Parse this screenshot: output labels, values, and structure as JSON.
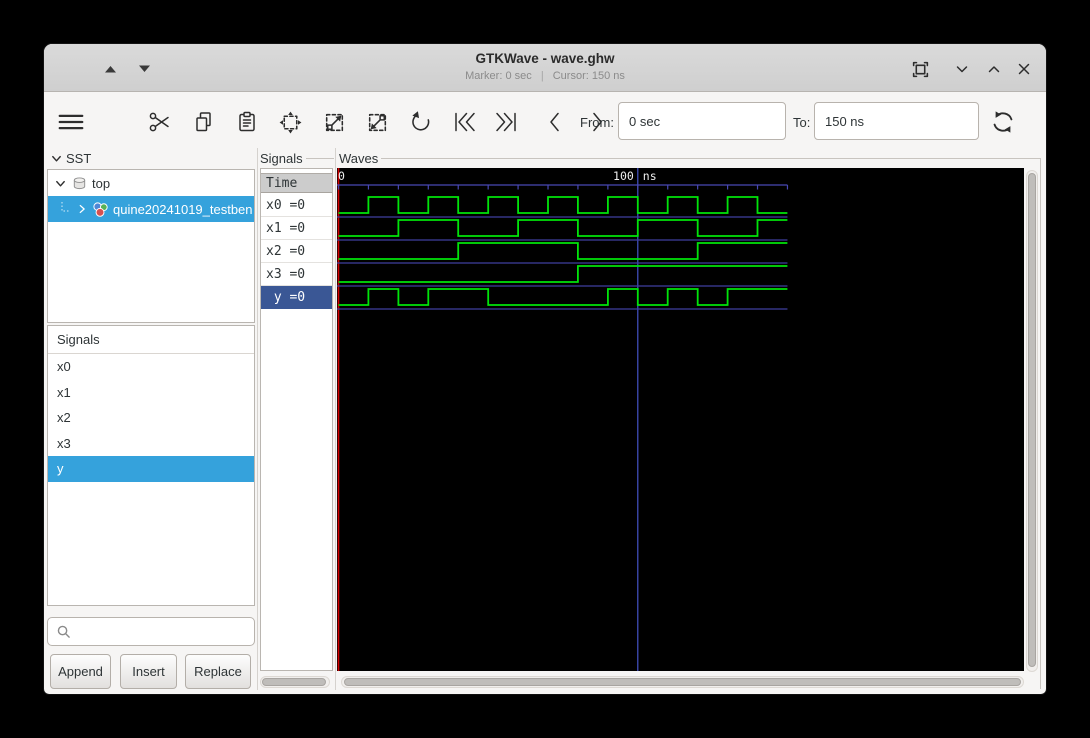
{
  "window": {
    "title": "GTKWave - wave.ghw",
    "subtitle_marker": "Marker: 0 sec",
    "subtitle_sep": "|",
    "subtitle_cursor": "Cursor: 150 ns"
  },
  "toolbar": {
    "from_label": "From:",
    "from_value": "0 sec",
    "to_label": "To:",
    "to_value": "150 ns"
  },
  "sst": {
    "header": "SST",
    "items": [
      {
        "label": "top",
        "expanded": true,
        "selected": false
      },
      {
        "label": "quine20241019_testben",
        "expanded": false,
        "selected": true
      }
    ]
  },
  "filter": {
    "header": "Signals",
    "items": [
      "x0",
      "x1",
      "x2",
      "x3",
      "y"
    ],
    "selected_item": "y",
    "search_placeholder": "",
    "buttons": [
      "Append",
      "Insert",
      "Replace"
    ]
  },
  "values_panel": {
    "header": "Signals",
    "time_header": "Time",
    "rows": [
      {
        "label": "x0 =0"
      },
      {
        "label": "x1 =0"
      },
      {
        "label": "x2 =0"
      },
      {
        "label": "x3 =0"
      },
      {
        "label": " y =0",
        "selected": true
      }
    ]
  },
  "waves_panel": {
    "header": "Waves"
  },
  "chart_data": {
    "type": "digital-waveform",
    "title": "Waves",
    "time_unit": "ns",
    "time_start": 0,
    "time_end": 150,
    "tick_interval_ns": 10,
    "ruler_labels": [
      {
        "time": 0,
        "number": "0",
        "unit": ""
      },
      {
        "time": 100,
        "number": "100",
        "unit": "ns"
      }
    ],
    "marker_time_ns": 0,
    "cursor_line_time_ns": 100,
    "signals": [
      {
        "name": "x0",
        "current_value": "0",
        "high_intervals_ns": [
          [
            10,
            20
          ],
          [
            30,
            40
          ],
          [
            50,
            60
          ],
          [
            70,
            80
          ],
          [
            90,
            100
          ],
          [
            110,
            120
          ],
          [
            130,
            140
          ]
        ]
      },
      {
        "name": "x1",
        "current_value": "0",
        "high_intervals_ns": [
          [
            20,
            40
          ],
          [
            60,
            80
          ],
          [
            100,
            120
          ],
          [
            140,
            150
          ]
        ]
      },
      {
        "name": "x2",
        "current_value": "0",
        "high_intervals_ns": [
          [
            40,
            80
          ],
          [
            120,
            150
          ]
        ]
      },
      {
        "name": "x3",
        "current_value": "0",
        "high_intervals_ns": [
          [
            80,
            150
          ]
        ]
      },
      {
        "name": "y",
        "current_value": "0",
        "selected": true,
        "high_intervals_ns": [
          [
            10,
            20
          ],
          [
            30,
            50
          ],
          [
            90,
            100
          ],
          [
            110,
            120
          ],
          [
            130,
            150
          ]
        ]
      }
    ],
    "colors": {
      "trace": "#00e40a",
      "baseline": "#3f3f9e",
      "ruler": "#4848b4",
      "cursor_line": "#4554c8",
      "marker": "#d40000",
      "background": "#000000",
      "tick_text": "#efefef"
    }
  }
}
